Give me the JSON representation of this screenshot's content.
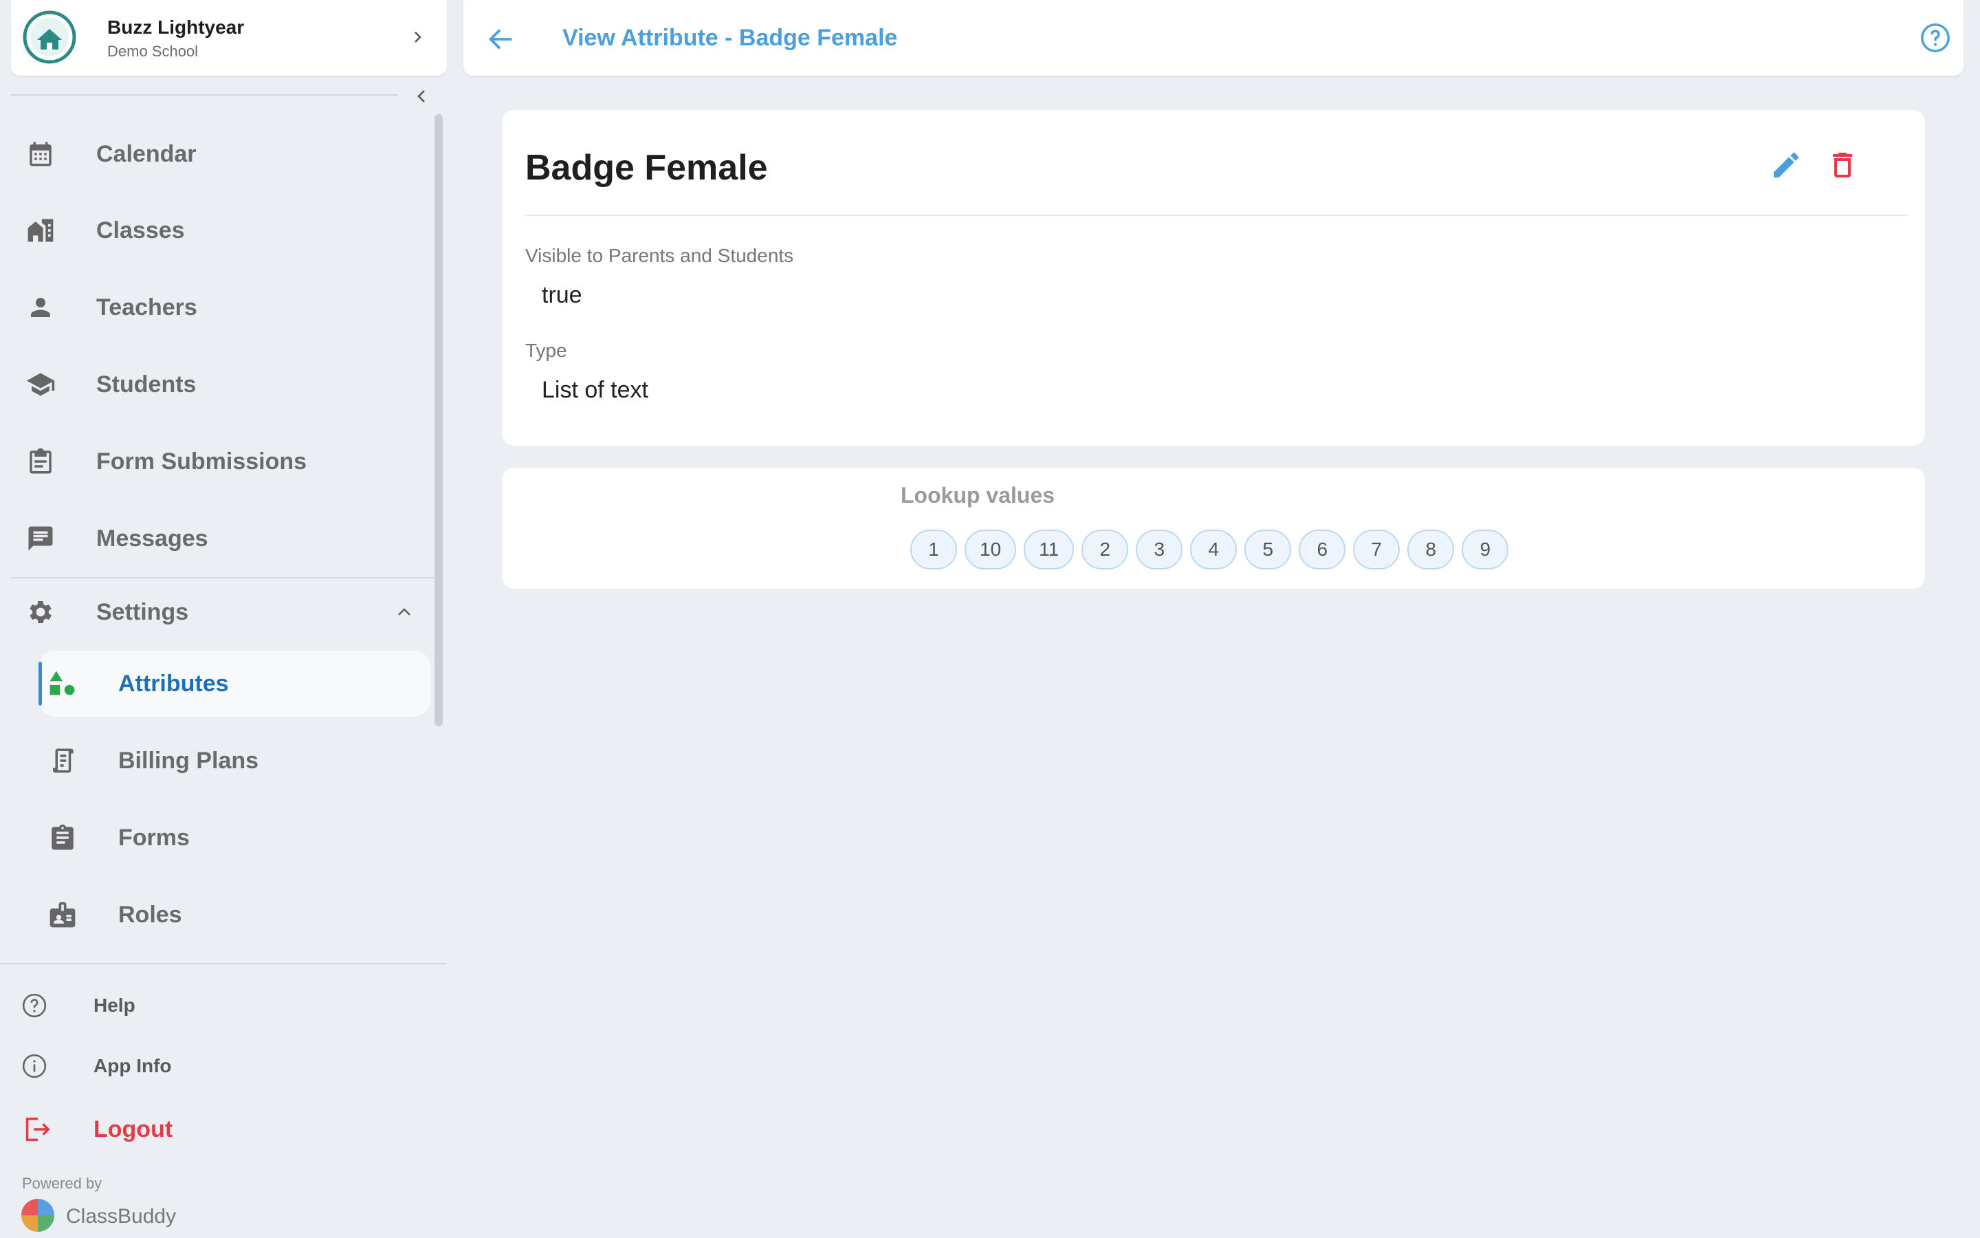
{
  "user": {
    "name": "Buzz Lightyear",
    "school": "Demo School"
  },
  "header": {
    "title": "View Attribute - Badge Female"
  },
  "nav": [
    {
      "label": "Calendar",
      "icon": "calendar-icon"
    },
    {
      "label": "Classes",
      "icon": "school-building-icon"
    },
    {
      "label": "Teachers",
      "icon": "person-icon"
    },
    {
      "label": "Students",
      "icon": "graduation-cap-icon"
    },
    {
      "label": "Form Submissions",
      "icon": "clipboard-list-icon"
    },
    {
      "label": "Messages",
      "icon": "message-icon"
    }
  ],
  "settings": {
    "label": "Settings",
    "icon": "gear-icon",
    "expanded": true,
    "items": [
      {
        "label": "Attributes",
        "icon": "shapes-icon",
        "active": true
      },
      {
        "label": "Billing Plans",
        "icon": "receipt-icon"
      },
      {
        "label": "Forms",
        "icon": "clipboard-icon"
      },
      {
        "label": "Roles",
        "icon": "id-badge-icon"
      }
    ]
  },
  "bottom": {
    "help": "Help",
    "app_info": "App Info",
    "logout": "Logout"
  },
  "footer": {
    "powered_by": "Powered by",
    "brand": "ClassBuddy"
  },
  "attribute": {
    "name": "Badge Female",
    "fields": [
      {
        "label": "Visible to Parents and Students",
        "value": "true"
      },
      {
        "label": "Type",
        "value": "List of text"
      }
    ]
  },
  "lookup": {
    "title": "Lookup values",
    "values": [
      "1",
      "10",
      "11",
      "2",
      "3",
      "4",
      "5",
      "6",
      "7",
      "8",
      "9"
    ]
  },
  "colors": {
    "accent": "#4b9fde",
    "active_text": "#1f6fb6",
    "danger": "#e53945",
    "icon_green": "#2aa84a",
    "background": "#ebeff4"
  }
}
